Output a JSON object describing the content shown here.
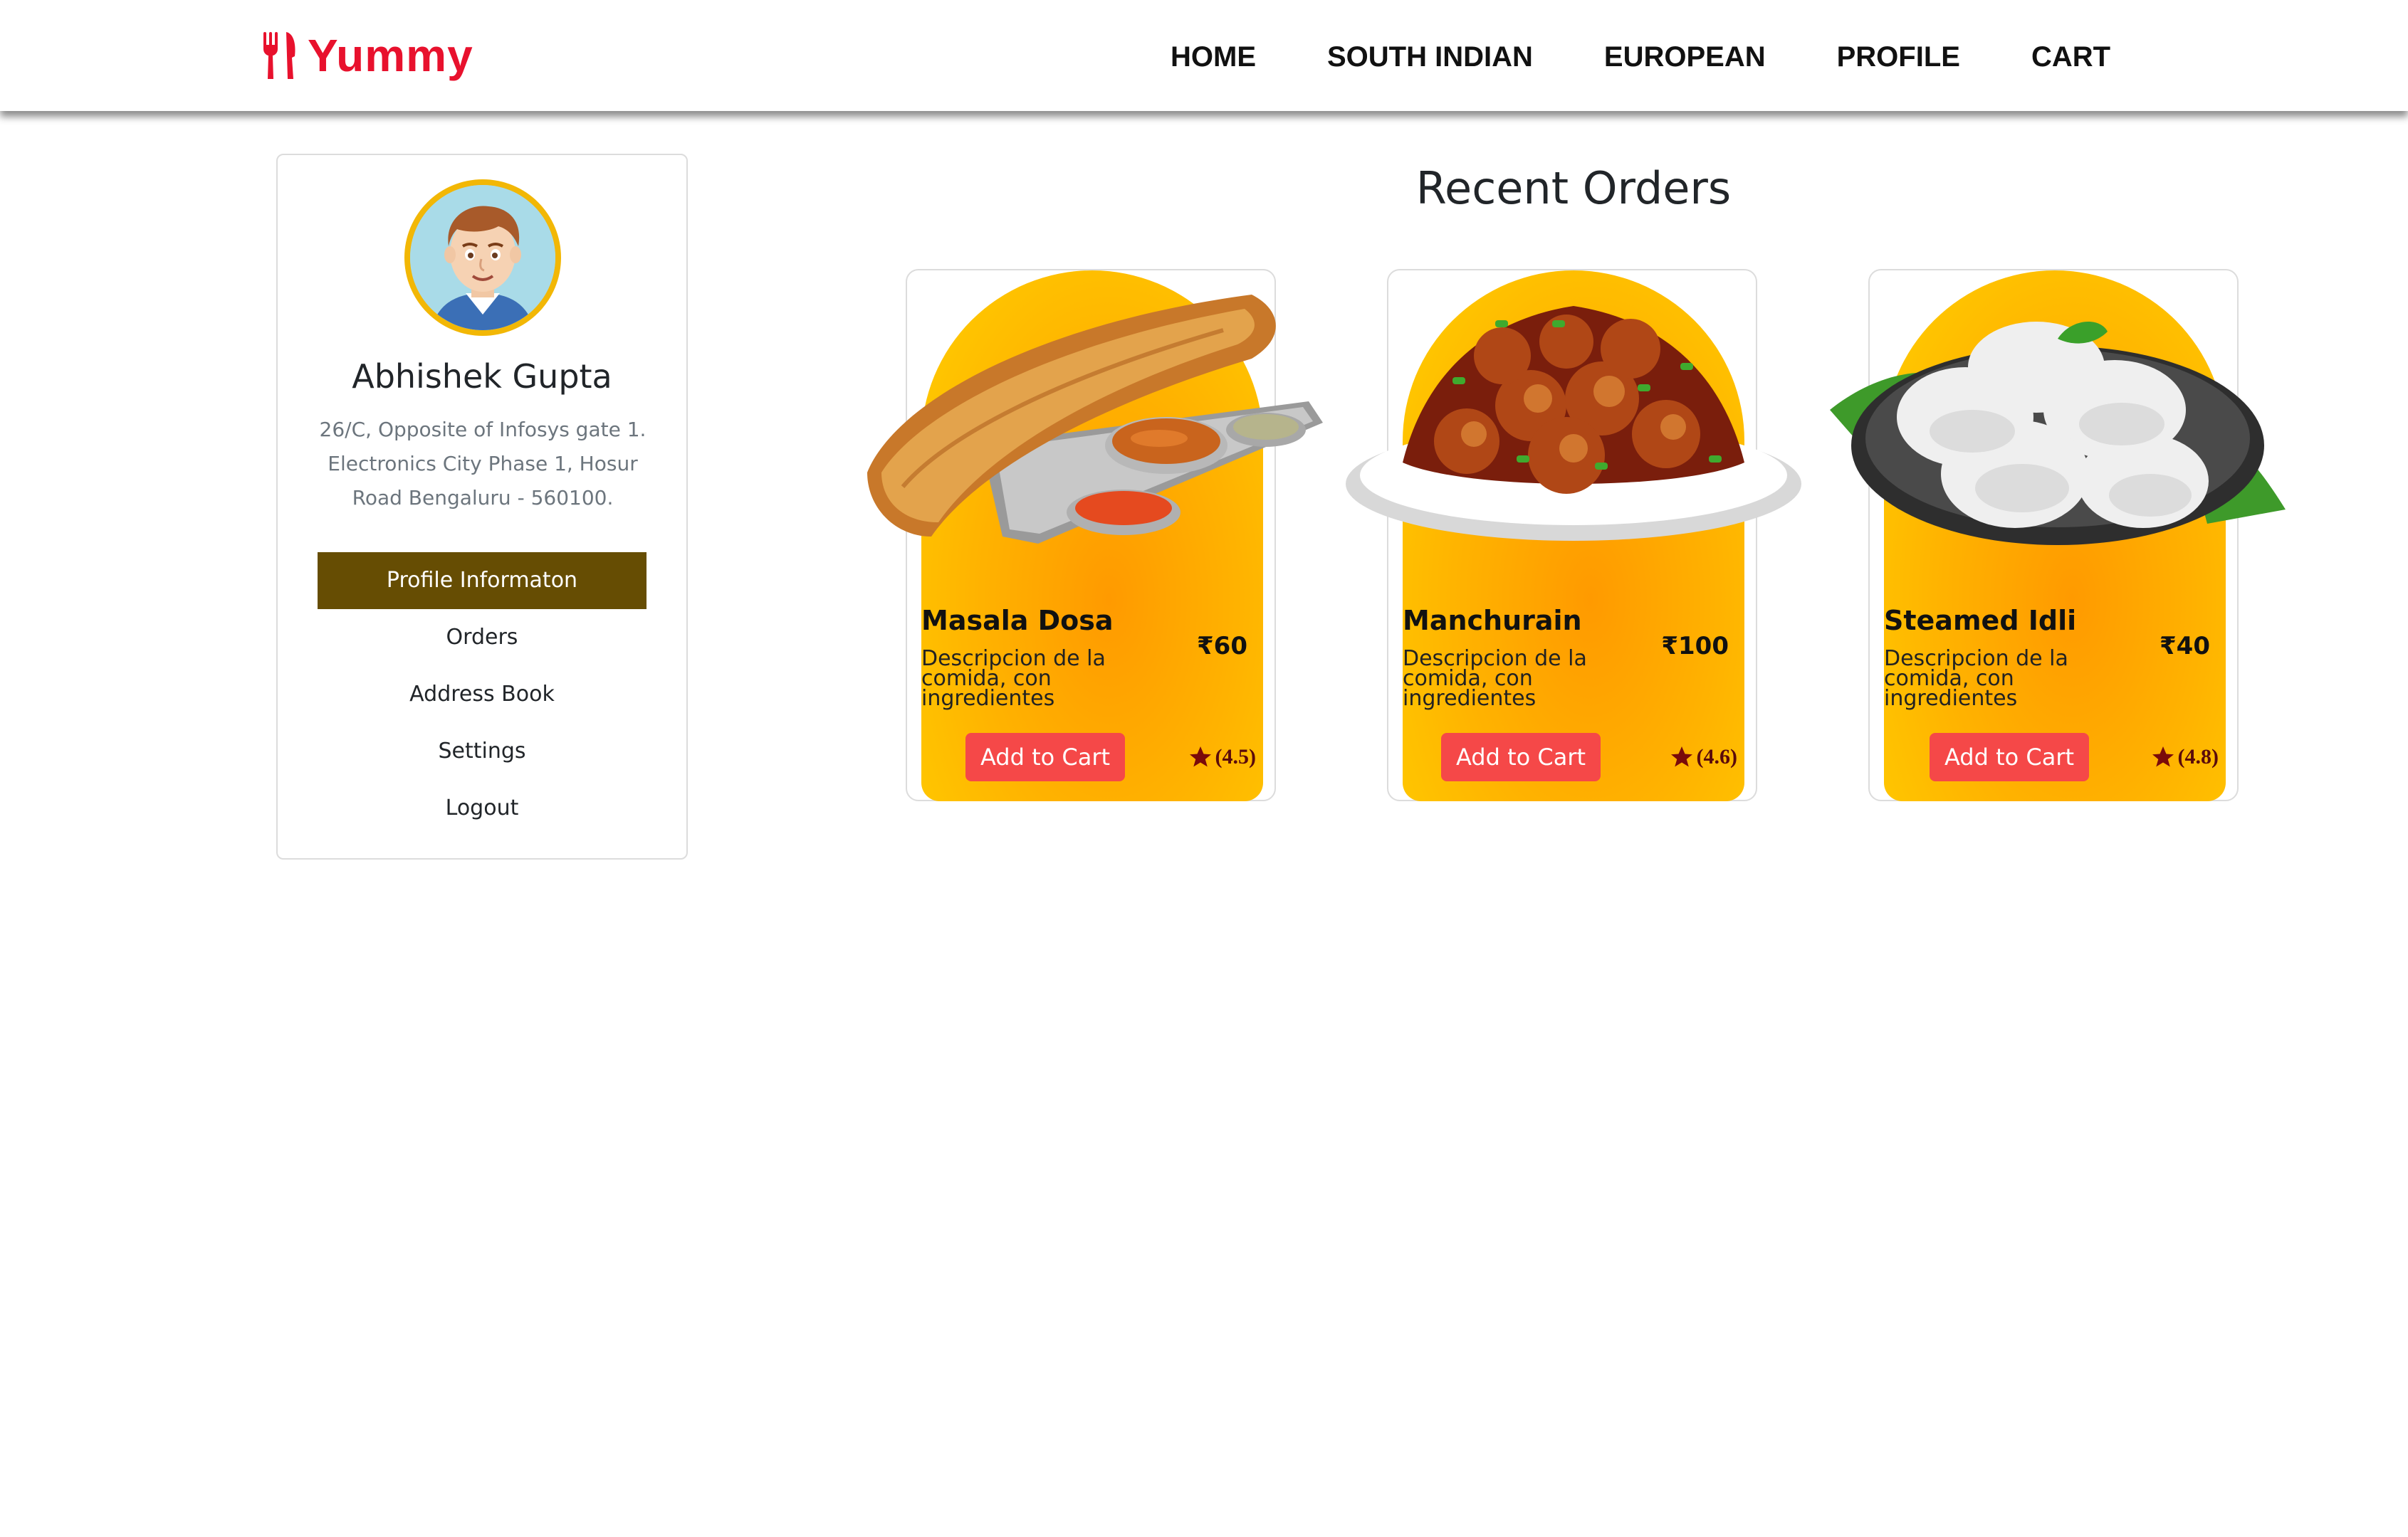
{
  "brand": {
    "name": "Yummy",
    "color": "#e8112d"
  },
  "nav": {
    "items": [
      {
        "label": "HOME"
      },
      {
        "label": "SOUTH INDIAN"
      },
      {
        "label": "EUROPEAN"
      },
      {
        "label": "PROFILE"
      },
      {
        "label": "CART"
      }
    ]
  },
  "profile": {
    "name": "Abhishek Gupta",
    "address": "26/C, Opposite of Infosys gate 1. Electronics City Phase 1, Hosur Road Bengaluru - 560100.",
    "menu": [
      {
        "label": "Profile Informaton",
        "active": true
      },
      {
        "label": "Orders",
        "active": false
      },
      {
        "label": "Address Book",
        "active": false
      },
      {
        "label": "Settings",
        "active": false
      },
      {
        "label": "Logout",
        "active": false
      }
    ],
    "active_color": "#664d03"
  },
  "orders": {
    "title": "Recent Orders",
    "items": [
      {
        "name": "Masala Dosa",
        "price": "₹60",
        "description": "Descripcion de la comida, con ingredientes",
        "button": "Add to Cart",
        "rating": "(4.5)",
        "image_icon": "masala-dosa-image"
      },
      {
        "name": "Manchurain",
        "price": "₹100",
        "description": "Descripcion de la comida, con ingredientes",
        "button": "Add to Cart",
        "rating": "(4.6)",
        "image_icon": "manchurian-image"
      },
      {
        "name": "Steamed Idli",
        "price": "₹40",
        "description": "Descripcion de la comida, con ingredientes",
        "button": "Add to Cart",
        "rating": "(4.8)",
        "image_icon": "idli-image"
      }
    ],
    "button_color": "#f54848"
  }
}
